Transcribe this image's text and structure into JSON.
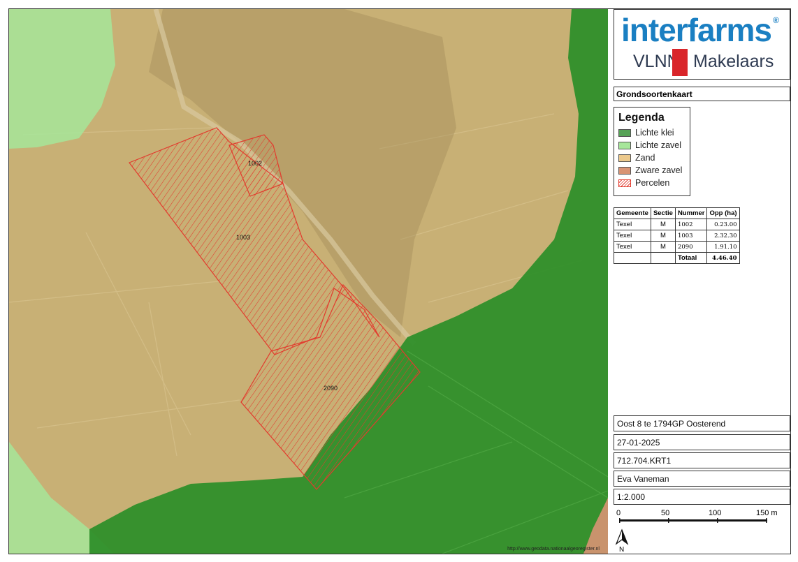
{
  "logo": {
    "brand": "interfarms",
    "registered": "®",
    "sub_left": "VLNN",
    "sub_right": "Makelaars",
    "brand_color": "#1a7fc2",
    "bar_color": "#d9252a"
  },
  "map_title": "Grondsoortenkaart",
  "legend": {
    "title": "Legenda",
    "items": [
      {
        "label": "Lichte klei",
        "color": "#57a357"
      },
      {
        "label": "Lichte zavel",
        "color": "#a6e69a"
      },
      {
        "label": "Zand",
        "color": "#ecc98c"
      },
      {
        "label": "Zware zavel",
        "color": "#d99474"
      },
      {
        "label": "Percelen",
        "color": "#e23b2e"
      }
    ]
  },
  "table": {
    "headers": [
      "Gemeente",
      "Sectie",
      "Nummer",
      "Opp (ha)"
    ],
    "rows": [
      {
        "gemeente": "Texel",
        "sectie": "M",
        "nummer": "1002",
        "opp": "0.23.00"
      },
      {
        "gemeente": "Texel",
        "sectie": "M",
        "nummer": "1003",
        "opp": "2.32.30"
      },
      {
        "gemeente": "Texel",
        "sectie": "M",
        "nummer": "2090",
        "opp": "1.91.10"
      }
    ],
    "total_label": "Totaal",
    "total_value": "4.46.40"
  },
  "info": {
    "address": "Oost 8 te 1794GP Oosterend",
    "date": "27-01-2025",
    "reference": "712.704.KRT1",
    "author": "Eva Vaneman",
    "scale": "1:2.000"
  },
  "scalebar": {
    "labels": [
      "0",
      "50",
      "100",
      "150 m"
    ]
  },
  "north_label": "N",
  "map": {
    "parcel_labels": [
      "1002",
      "1003",
      "2090"
    ],
    "source_url": "http://www.geodata.nationaalgeoregister.nl"
  }
}
